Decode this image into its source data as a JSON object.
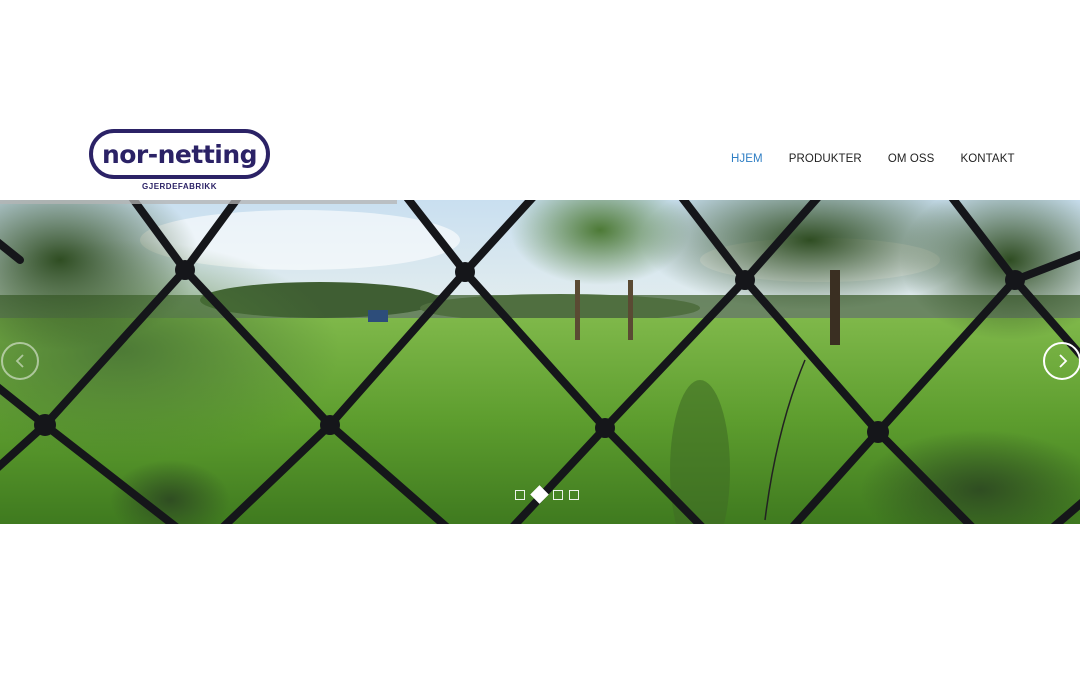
{
  "logo": {
    "text": "nor-netting",
    "subtitle": "GJERDEFABRIKK"
  },
  "nav": {
    "items": [
      {
        "label": "HJEM",
        "active": true
      },
      {
        "label": "PRODUKTER",
        "active": false
      },
      {
        "label": "OM OSS",
        "active": false
      },
      {
        "label": "KONTAKT",
        "active": false
      }
    ]
  },
  "slider": {
    "image": "chain-link fence in front of green field and trees",
    "slide_count": 4,
    "active_slide": 2,
    "prev_icon": "chevron-left-icon",
    "next_icon": "chevron-right-icon"
  },
  "colors": {
    "brand": "#2b2266",
    "nav_active": "#2e7ec4",
    "nav_text": "#222222"
  }
}
